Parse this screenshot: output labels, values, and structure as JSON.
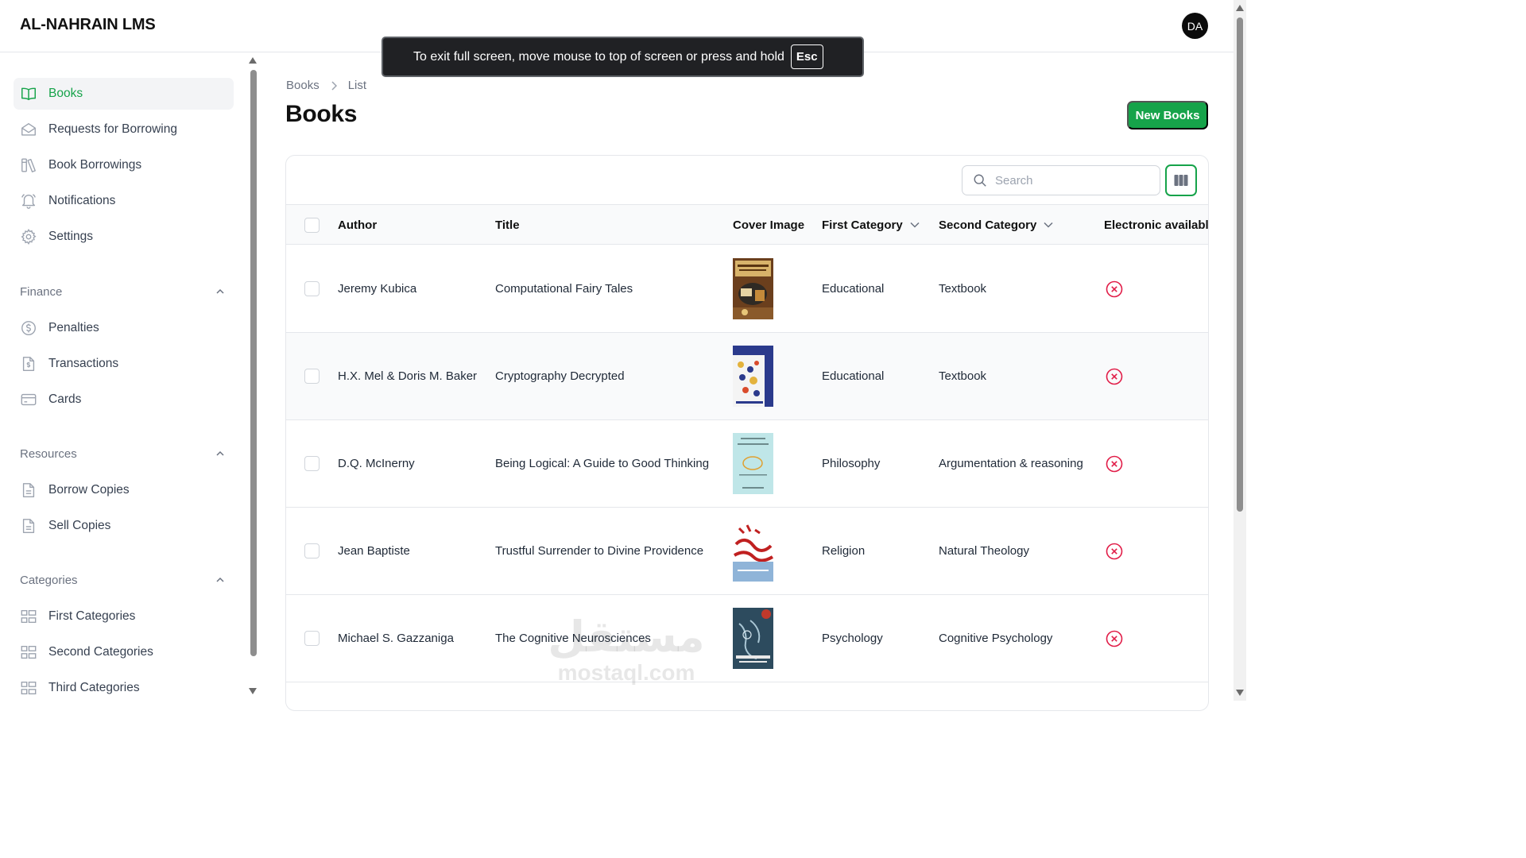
{
  "app": {
    "brand": "AL-NAHRAIN LMS",
    "avatar_initials": "DA"
  },
  "fullscreen_toast": {
    "message": "To exit full screen, move mouse to top of screen or press and hold",
    "key": "Esc"
  },
  "sidebar": {
    "main_items": [
      {
        "label": "Books",
        "icon": "book-open-icon",
        "active": true
      },
      {
        "label": "Requests for Borrowing",
        "icon": "envelope-open-icon"
      },
      {
        "label": "Book Borrowings",
        "icon": "book-lean-icon"
      },
      {
        "label": "Notifications",
        "icon": "bell-icon"
      },
      {
        "label": "Settings",
        "icon": "gear-icon"
      }
    ],
    "groups": [
      {
        "label": "Finance",
        "items": [
          {
            "label": "Penalties",
            "icon": "dollar-circle-icon"
          },
          {
            "label": "Transactions",
            "icon": "dollar-document-icon"
          },
          {
            "label": "Cards",
            "icon": "credit-card-icon"
          }
        ]
      },
      {
        "label": "Resources",
        "items": [
          {
            "label": "Borrow Copies",
            "icon": "document-icon"
          },
          {
            "label": "Sell Copies",
            "icon": "document-icon"
          }
        ]
      },
      {
        "label": "Categories",
        "items": [
          {
            "label": "First Categories",
            "icon": "category-boxes-icon"
          },
          {
            "label": "Second Categories",
            "icon": "category-boxes-icon"
          },
          {
            "label": "Third Categories",
            "icon": "category-boxes-icon"
          }
        ]
      }
    ]
  },
  "breadcrumb": {
    "root": "Books",
    "current": "List"
  },
  "page": {
    "title": "Books",
    "new_button": "New Books"
  },
  "search": {
    "placeholder": "Search"
  },
  "table": {
    "columns": {
      "author": "Author",
      "title": "Title",
      "cover": "Cover Image",
      "first_category": "First Category",
      "second_category": "Second Category",
      "electronic": "Electronic available"
    },
    "rows": [
      {
        "author": "Jeremy Kubica",
        "title": "Computational Fairy Tales",
        "first_category": "Educational",
        "second_category": "Textbook",
        "electronic": false
      },
      {
        "author": "H.X. Mel & Doris M. Baker",
        "title": "Cryptography Decrypted",
        "first_category": "Educational",
        "second_category": "Textbook",
        "electronic": false
      },
      {
        "author": "D.Q. McInerny",
        "title": "Being Logical: A Guide to Good Thinking",
        "first_category": "Philosophy",
        "second_category": "Argumentation & reasoning",
        "electronic": false
      },
      {
        "author": "Jean Baptiste",
        "title": "Trustful Surrender to Divine Providence",
        "first_category": "Religion",
        "second_category": "Natural Theology",
        "electronic": false
      },
      {
        "author": "Michael S. Gazzaniga",
        "title": "The Cognitive Neurosciences",
        "first_category": "Psychology",
        "second_category": "Cognitive Psychology",
        "electronic": false
      }
    ]
  },
  "watermark": {
    "arabic": "مستقل",
    "latin": "mostaql.com"
  },
  "colors": {
    "accent": "#16a34a",
    "danger": "#e11d48",
    "toast_bg": "#202124"
  }
}
